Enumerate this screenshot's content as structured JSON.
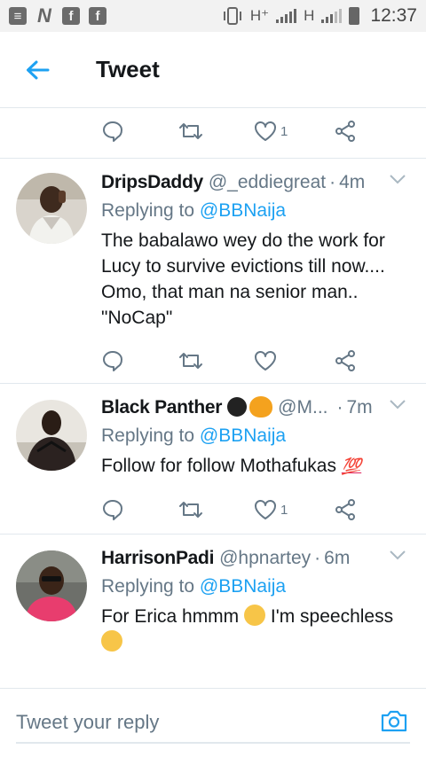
{
  "status_bar": {
    "left_icons": [
      "mail-icon",
      "n-icon",
      "facebook-icon",
      "facebook-icon"
    ],
    "network_1": "H⁺",
    "network_2": "H",
    "time": "12:37"
  },
  "header": {
    "title": "Tweet"
  },
  "top_actions": {
    "like_count": "1"
  },
  "tweets": [
    {
      "name": "DripsDaddy",
      "handle": "@_eddiegreat",
      "time": "4m",
      "replying_prefix": "Replying to",
      "replying_to": "@BBNaija",
      "body": "The babalawo wey do the work for Lucy to survive evictions till now.... Omo, that man na senior man.. \"NoCap\"",
      "like_count": ""
    },
    {
      "name": "Black Panther",
      "handle": "@M...",
      "time": "7m",
      "replying_prefix": "Replying to",
      "replying_to": "@BBNaija",
      "body": "Follow for follow Mothafukas",
      "emoji_100": "💯",
      "like_count": "1"
    },
    {
      "name": "HarrisonPadi",
      "handle": "@hpnartey",
      "time": "6m",
      "replying_prefix": "Replying to",
      "replying_to": "@BBNaija",
      "body_a": "For Erica hmmm",
      "body_b": "I'm speechless",
      "like_count": ""
    }
  ],
  "reply_bar": {
    "placeholder": "Tweet your reply"
  },
  "colors": {
    "accent": "#1da1f2",
    "secondary_text": "#657786",
    "divider": "#e1e8ed"
  }
}
